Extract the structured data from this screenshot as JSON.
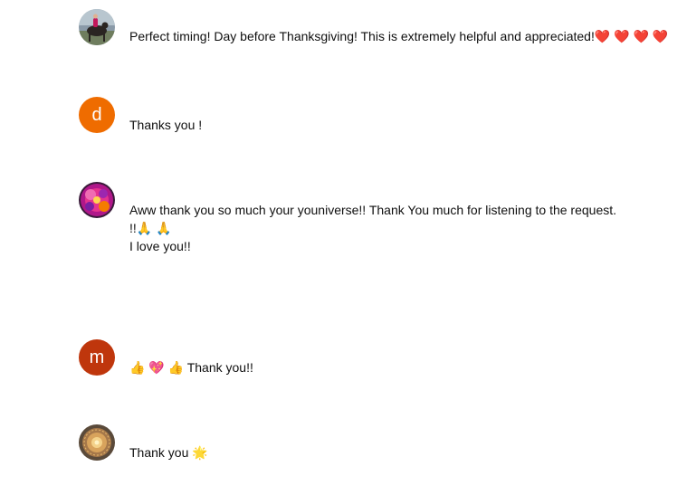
{
  "comments": [
    {
      "avatar": {
        "kind": "photo",
        "icon": "person-on-horse-photo"
      },
      "text": "Perfect timing! Day before Thanksgiving! This is extremely helpful and appreciated!❤️ ❤️ ❤️ ❤️"
    },
    {
      "avatar": {
        "kind": "letter",
        "letter": "d",
        "color": "#ef6c00"
      },
      "text": "Thanks you !"
    },
    {
      "avatar": {
        "kind": "photo",
        "icon": "pink-flower-photo"
      },
      "text": "Aww thank you so much your youniverse!! Thank You much for listening to the request.\n!!🙏 🙏\nI love you!!"
    },
    {
      "avatar": {
        "kind": "letter",
        "letter": "m",
        "color": "#bf360c"
      },
      "text": "👍 💖 👍 Thank you!!"
    },
    {
      "avatar": {
        "kind": "photo",
        "icon": "golden-mandala-photo"
      },
      "text": "Thank you 🌟"
    }
  ]
}
